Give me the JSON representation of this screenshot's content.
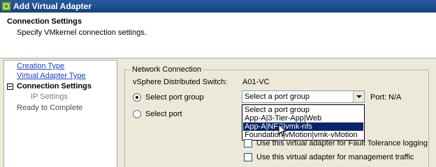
{
  "window": {
    "title": "Add Virtual Adapter",
    "icon": "vsphere-app-icon"
  },
  "header": {
    "title": "Connection Settings",
    "subtitle": "Specify VMkernel connection settings."
  },
  "nav": {
    "items": [
      {
        "label": "Creation Type",
        "state": "link"
      },
      {
        "label": "Virtual Adapter Type",
        "state": "link"
      },
      {
        "label": "Connection Settings",
        "state": "current"
      },
      {
        "label": "IP Settings",
        "state": "sub"
      },
      {
        "label": "Ready to Complete",
        "state": "future"
      }
    ]
  },
  "network": {
    "group_title": "Network Connection",
    "switch_label": "vSphere Distributed Switch:",
    "switch_value": "A01-VC",
    "port_group_label": "Select port group",
    "port_label": "Select port",
    "port_group_combo": "Select a port group",
    "port_readout_label": "Port:",
    "port_readout_value": "N/A",
    "dropdown_options": [
      {
        "label": "Select a port group",
        "selected": false
      },
      {
        "label": "App-A|3-Tier-App|Web",
        "selected": false
      },
      {
        "label": "App-A|NFS|vmk-nfs",
        "selected": true
      },
      {
        "label": "Foundation|vMotion|vmk-vMotion",
        "selected": false
      }
    ],
    "checkboxes": [
      {
        "label": "Use this virtual adapter for Fault Tolerance logging",
        "checked": false
      },
      {
        "label": "Use this virtual adapter for management traffic",
        "checked": false
      }
    ]
  },
  "colors": {
    "title_bar": "#1e4f91",
    "link": "#1a3ec9",
    "selection": "#0a246a",
    "dialog_bg": "#ece9d8"
  }
}
